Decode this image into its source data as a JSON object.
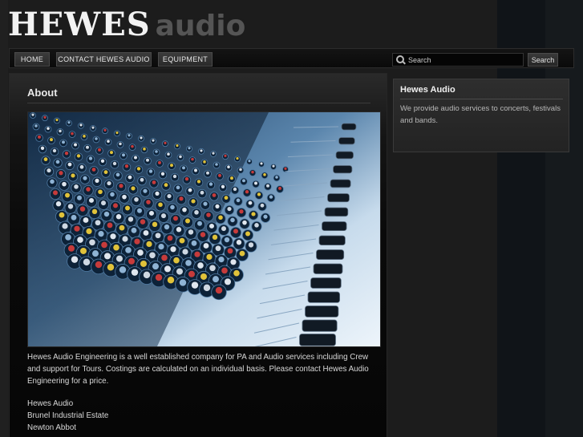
{
  "logo": {
    "main": "HEWES",
    "sub": "audio"
  },
  "nav": {
    "items": [
      {
        "label": "HOME"
      },
      {
        "label": "CONTACT HEWES AUDIO"
      },
      {
        "label": "EQUIPMENT"
      }
    ],
    "search": {
      "placeholder": "Search",
      "button_label": "Search"
    }
  },
  "main": {
    "title": "About",
    "intro": "Hewes Audio Engineering is a well established company for PA and Audio services including Crew and support for Tours. Costings are calculated on an individual basis. Please contact Hewes Audio Engineering for a price.",
    "address": [
      "Hewes Audio",
      "Brunel Industrial Estate",
      "Newton Abbot"
    ]
  },
  "sidebar": {
    "title": "Hewes Audio",
    "text": "We provide audio services to concerts, festivals and bands."
  },
  "colors": {
    "background": "#1c1c1c",
    "panel": "#2a2a2a",
    "text": "#d8d8d8"
  }
}
